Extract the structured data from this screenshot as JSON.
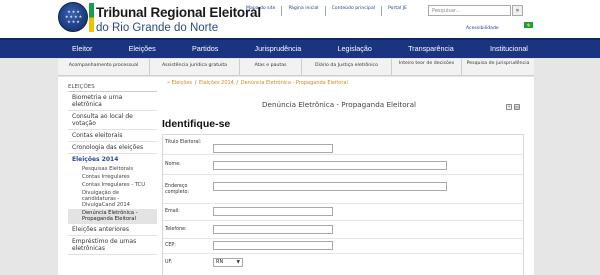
{
  "brand": {
    "title": "Tribunal Regional Eleitoral",
    "subtitle": "do Rio Grande do Norte"
  },
  "toplinks": [
    "Mapa do site",
    "Página inicial",
    "Conteúdo principal",
    "Portal JE"
  ],
  "search": {
    "placeholder": "Pesquisar...",
    "button_icon": "»"
  },
  "accessibility": "Acessibilidade",
  "main_nav": [
    "Eleitor",
    "Eleições",
    "Partidos",
    "Jurisprudência",
    "Legislação",
    "Transparência",
    "Institucional"
  ],
  "sub_nav": [
    "Acompanhamento processual",
    "Assistência jurídica gratuita",
    "Atas e pautas",
    "Diário da Justiça eletrônico",
    "Inteiro teor de decisões",
    "Pesquisa de jurisprudência"
  ],
  "sidebar": {
    "title": "ELEIÇÕES",
    "items": [
      {
        "label": "Biometria e urna eletrônica"
      },
      {
        "label": "Consulta ao local de votação"
      },
      {
        "label": "Contas eleitorais"
      },
      {
        "label": "Cronologia das eleições"
      }
    ],
    "section": "Eleições 2014",
    "sub_items": [
      "Pesquisas Eleitorais",
      "Contas Irregulares",
      "Contas Irregulares - TCU",
      "Divulgação de candidaturas - DivulgaCand 2014",
      "Denúncia Eletrônica - Propaganda Eleitoral"
    ],
    "after": [
      "Eleições anteriores",
      "Empréstimo de urnas eletrônicas"
    ]
  },
  "breadcrumb": {
    "prefix": "» ",
    "items": [
      "Eleições",
      "Eleições 2014",
      "Denúncia Eletrônica - Propaganda Eleitoral"
    ],
    "separator": " / "
  },
  "page_title": "Denúncia Eletrônica - Propaganda Eleitoral",
  "tools": [
    "zoom-in-icon",
    "print-icon"
  ],
  "section_heading": "Identifique-se",
  "form": {
    "fields": [
      {
        "label": "Título Eleitoral:"
      },
      {
        "label": "Nome:"
      },
      {
        "label": "Endereço completo:"
      },
      {
        "label": "Email:"
      },
      {
        "label": "Telefone:"
      },
      {
        "label": "CEP:"
      },
      {
        "label": "UF:",
        "value": "RN"
      }
    ]
  },
  "colors": {
    "nav_bg": "#1a3480",
    "breadcrumb": "#d08a20",
    "sidebar_highlight": "#1f4a9e"
  }
}
